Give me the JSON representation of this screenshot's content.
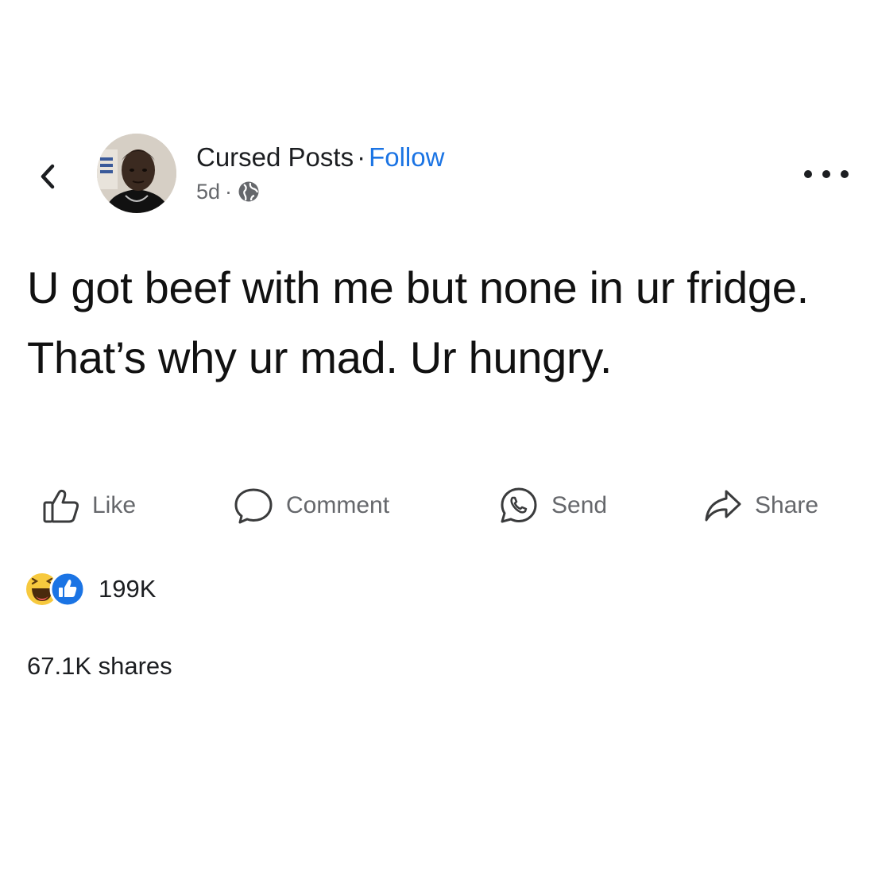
{
  "post": {
    "author": "Cursed Posts",
    "separator": "·",
    "follow_label": "Follow",
    "time": "5d",
    "meta_separator": "·",
    "privacy_icon": "globe-icon",
    "text": "U got beef with me but none in ur fridge. That’s why ur mad. Ur hungry."
  },
  "actions": {
    "like_label": "Like",
    "comment_label": "Comment",
    "send_label": "Send",
    "share_label": "Share"
  },
  "stats": {
    "reaction_count": "199K",
    "shares_text": "67.1K shares"
  },
  "colors": {
    "accent": "#1b74e4",
    "text": "#1c1e21",
    "muted": "#65676b",
    "background": "#ffffff"
  }
}
